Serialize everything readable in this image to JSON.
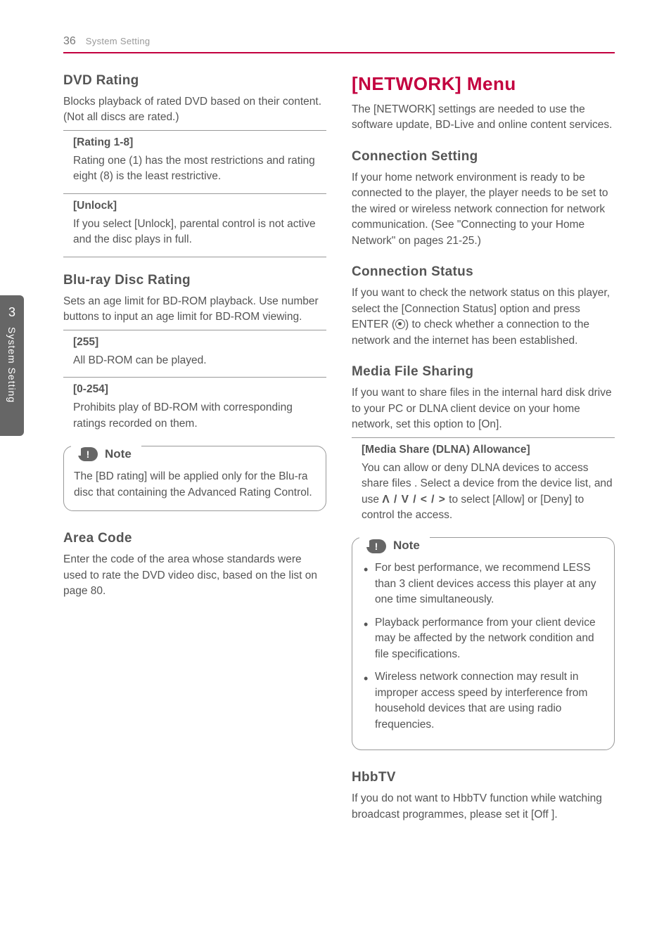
{
  "header": {
    "page_number": "36",
    "section": "System Setting"
  },
  "side_tab": {
    "number": "3",
    "label": "System Setting"
  },
  "left": {
    "dvd_rating": {
      "title": "DVD Rating",
      "intro": "Blocks playback of rated DVD based on their content. (Not all discs are rated.)",
      "items": [
        {
          "title": "[Rating 1-8]",
          "body": "Rating one (1) has the most restrictions and rating eight (8) is the least restrictive."
        },
        {
          "title": "[Unlock]",
          "body": "If you select [Unlock], parental control is not active and the disc plays in full."
        }
      ]
    },
    "bd_rating": {
      "title": "Blu-ray Disc Rating",
      "intro": "Sets an age limit for BD-ROM playback. Use number buttons to input an age limit for BD-ROM viewing.",
      "items": [
        {
          "title": "[255]",
          "body": "All BD-ROM can be played."
        },
        {
          "title": "[0-254]",
          "body": "Prohibits play of BD-ROM with corresponding ratings recorded on them."
        }
      ],
      "note_label": "Note",
      "note_body": "The [BD rating] will be applied only for the Blu-ra disc that containing the Advanced Rating Control."
    },
    "area_code": {
      "title": "Area Code",
      "body": "Enter the code of the area whose standards were used to rate the DVD video disc, based on the list on page 80."
    }
  },
  "right": {
    "menu_title": "[NETWORK] Menu",
    "menu_intro": "The [NETWORK] settings are needed to use the software update, BD-Live and online content services.",
    "conn_setting": {
      "title": "Connection Setting",
      "body": "If your home network environment is ready to be connected to the player, the player needs to be set to the wired or wireless network connection for network communication. (See \"Connecting to your Home Network\" on pages 21-25.)"
    },
    "conn_status": {
      "title": "Connection Status",
      "body_pre": "If you want to check the network status on this player, select the [Connection Status] option and press ENTER (",
      "body_post": ") to check whether a connection to the network and the internet has been established."
    },
    "media_sharing": {
      "title": "Media File Sharing",
      "intro": "If you want to share files in the internal hard disk drive to your PC or DLNA client device on your home network, set this option to [On].",
      "item_title": "[Media Share (DLNA) Allowance]",
      "item_body_pre": "You can allow or deny DLNA devices to access share files . Select a device from the device list, and use ",
      "item_glyphs": "Ʌ / V / < / >",
      "item_body_post": " to select [Allow] or [Deny] to control the access.",
      "note_label": "Note",
      "notes": [
        "For best performance, we recommend LESS than 3 client devices access this player at any one time simultaneously.",
        "Playback performance from your client device may be affected by the network condition and file specifications.",
        "Wireless network connection may result in improper access speed by interference from household devices that are using radio frequencies."
      ]
    },
    "hbbtv": {
      "title": "HbbTV",
      "body": "If you do not want to HbbTV function while watching broadcast programmes, please set it [Off ]."
    }
  }
}
